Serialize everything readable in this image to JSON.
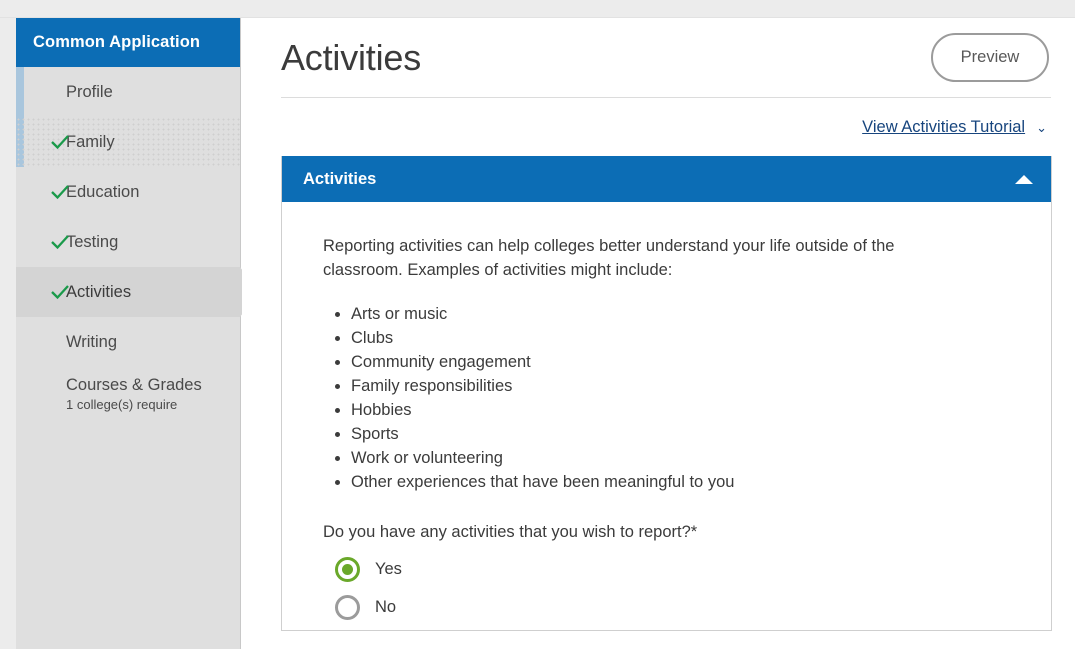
{
  "sidebar": {
    "title": "Common Application",
    "items": [
      {
        "label": "Profile",
        "checked": false,
        "active": false,
        "sub": ""
      },
      {
        "label": "Family",
        "checked": true,
        "active": false,
        "sub": ""
      },
      {
        "label": "Education",
        "checked": true,
        "active": false,
        "sub": ""
      },
      {
        "label": "Testing",
        "checked": true,
        "active": false,
        "sub": ""
      },
      {
        "label": "Activities",
        "checked": true,
        "active": true,
        "sub": ""
      },
      {
        "label": "Writing",
        "checked": false,
        "active": false,
        "sub": ""
      },
      {
        "label": "Courses & Grades",
        "checked": false,
        "active": false,
        "sub": "1 college(s) require"
      }
    ],
    "check_glyph": "✓"
  },
  "header": {
    "title": "Activities",
    "preview_label": "Preview"
  },
  "tutorial": {
    "link_label": "View Activities Tutorial",
    "chevron_glyph": "⌄"
  },
  "card": {
    "header_title": "Activities",
    "intro": "Reporting activities can help colleges better understand your life outside of the classroom. Examples of activities might include:",
    "examples": [
      "Arts or music",
      "Clubs",
      "Community engagement",
      "Family responsibilities",
      "Hobbies",
      "Sports",
      "Work or volunteering",
      "Other experiences that have been meaningful to you"
    ],
    "question": "Do you have any activities that you wish to report?",
    "required_marker": "*",
    "options": [
      {
        "label": "Yes",
        "selected": true
      },
      {
        "label": "No",
        "selected": false
      }
    ]
  },
  "colors": {
    "brand_blue": "#0c6db5",
    "check_green": "#1a9a4a",
    "radio_green": "#6aa82a",
    "link_blue": "#17457e",
    "sidebar_bg": "#dfdfdf",
    "active_row": "#d4d4d4"
  }
}
